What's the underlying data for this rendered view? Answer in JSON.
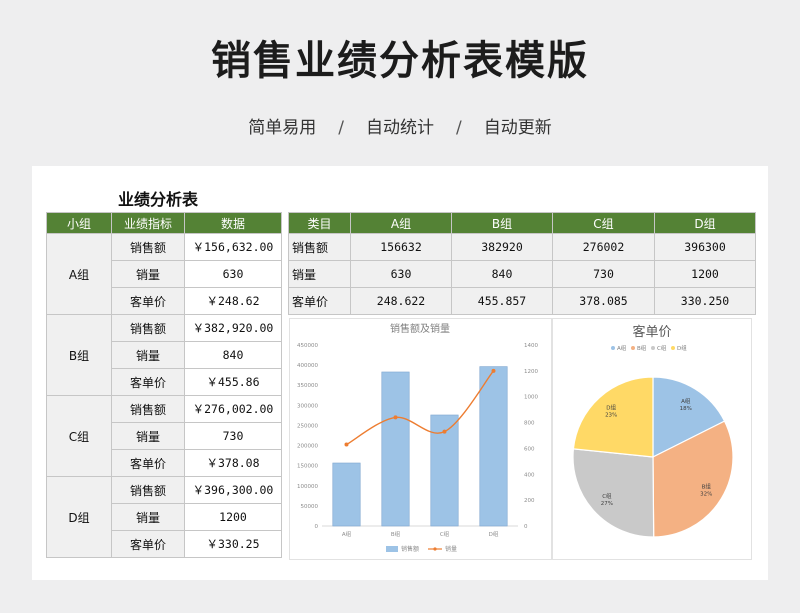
{
  "header": {
    "title": "销售业绩分析表模版",
    "subtitle_items": [
      "简单易用",
      "自动统计",
      "自动更新"
    ],
    "separator": "/"
  },
  "sheet": {
    "title": "业绩分析表",
    "left_table": {
      "headers": [
        "小组",
        "业绩指标",
        "数据"
      ],
      "groups": [
        {
          "name": "A组",
          "rows": [
            {
              "metric": "销售额",
              "value": "￥156,632.00"
            },
            {
              "metric": "销量",
              "value": "630"
            },
            {
              "metric": "客单价",
              "value": "￥248.62"
            }
          ]
        },
        {
          "name": "B组",
          "rows": [
            {
              "metric": "销售额",
              "value": "￥382,920.00"
            },
            {
              "metric": "销量",
              "value": "840"
            },
            {
              "metric": "客单价",
              "value": "￥455.86"
            }
          ]
        },
        {
          "name": "C组",
          "rows": [
            {
              "metric": "销售额",
              "value": "￥276,002.00"
            },
            {
              "metric": "销量",
              "value": "730"
            },
            {
              "metric": "客单价",
              "value": "￥378.08"
            }
          ]
        },
        {
          "name": "D组",
          "rows": [
            {
              "metric": "销售额",
              "value": "￥396,300.00"
            },
            {
              "metric": "销量",
              "value": "1200"
            },
            {
              "metric": "客单价",
              "value": "￥330.25"
            }
          ]
        }
      ]
    },
    "right_table": {
      "headers": [
        "类目",
        "A组",
        "B组",
        "C组",
        "D组"
      ],
      "rows": [
        {
          "label": "销售额",
          "values": [
            "156632",
            "382920",
            "276002",
            "396300"
          ]
        },
        {
          "label": "销量",
          "values": [
            "630",
            "840",
            "730",
            "1200"
          ]
        },
        {
          "label": "客单价",
          "values": [
            "248.622",
            "455.857",
            "378.085",
            "330.250"
          ]
        }
      ]
    }
  },
  "colors": {
    "header_green": "#548235",
    "bar_blue": "#9dc3e6",
    "line_orange": "#ed7d31",
    "pie_a": "#9dc3e6",
    "pie_b": "#f4b183",
    "pie_c": "#c9c9c9",
    "pie_d": "#ffd966"
  },
  "chart_data": [
    {
      "type": "bar",
      "title": "销售额及销量",
      "categories": [
        "A组",
        "B组",
        "C组",
        "D组"
      ],
      "series": [
        {
          "name": "销售额",
          "type": "bar",
          "axis": "left",
          "values": [
            156632,
            382920,
            276002,
            396300
          ]
        },
        {
          "name": "销量",
          "type": "line",
          "axis": "right",
          "values": [
            630,
            840,
            730,
            1200
          ]
        }
      ],
      "ylim_left": [
        0,
        450000
      ],
      "yticks_left": [
        "0",
        "50000",
        "100000",
        "150000",
        "200000",
        "250000",
        "300000",
        "350000",
        "400000",
        "450000"
      ],
      "ylim_right": [
        0,
        1400
      ],
      "yticks_right": [
        "0",
        "200",
        "400",
        "600",
        "800",
        "1000",
        "1200",
        "1400"
      ],
      "grid": false,
      "legend": "bottom"
    },
    {
      "type": "pie",
      "title": "客单价",
      "categories": [
        "A组",
        "B组",
        "C组",
        "D组"
      ],
      "values": [
        248.622,
        455.857,
        378.085,
        330.25
      ],
      "labels": [
        "18%",
        "32%",
        "27%",
        "23%"
      ],
      "legend": "top"
    }
  ]
}
